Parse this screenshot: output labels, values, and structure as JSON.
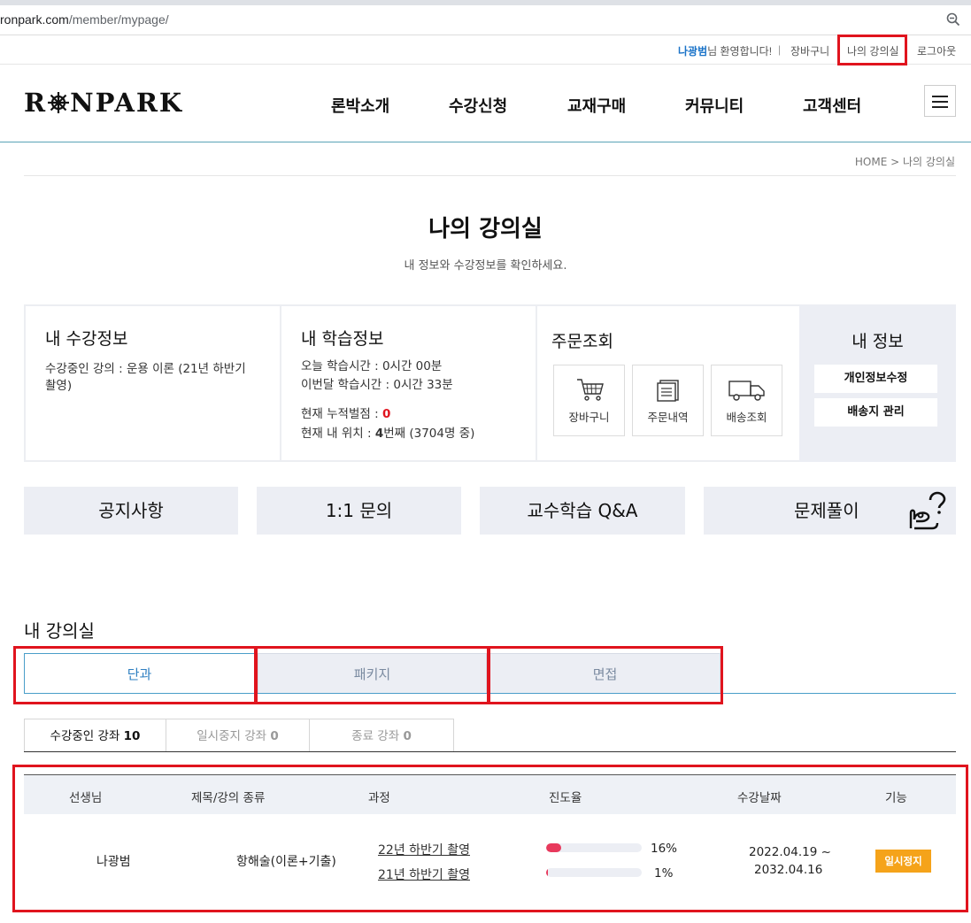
{
  "browser": {
    "url_host": "ronpark.com",
    "url_path": "/member/mypage/",
    "zoom_icon": "zoom-out-icon"
  },
  "util_nav": {
    "user_name": "나광범",
    "welcome_suffix": "님 환영합니다!",
    "separator": "|",
    "cart": "장바구니",
    "my_classroom": "나의 강의실",
    "logout": "로그아웃"
  },
  "header": {
    "logo_left": "R",
    "logo_right": "NPARK",
    "logo_icon": "ship-wheel-icon",
    "nav": [
      "론박소개",
      "수강신청",
      "교재구매",
      "커뮤니티",
      "고객센터"
    ],
    "menu_icon": "hamburger-icon"
  },
  "breadcrumb": "HOME > 나의 강의실",
  "page": {
    "title": "나의 강의실",
    "subtitle": "내 정보와 수강정보를 확인하세요."
  },
  "info": {
    "course_info": {
      "title": "내 수강정보",
      "line1": "수강중인 강의 : 운용 이론 (21년 하반기",
      "line2": "촬영)"
    },
    "study_info": {
      "title": "내 학습정보",
      "today_label": "오늘 학습시간 : ",
      "today_value": "0시간 00분",
      "month_label": "이번달 학습시간 : ",
      "month_value": "0시간 33분",
      "penalty_label": "현재 누적벌점 : ",
      "penalty_value": "0",
      "rank_label": "현재 내 위치 : ",
      "rank_value": "4",
      "rank_suffix": "번째 (3704명 중)"
    },
    "orders": {
      "title": "주문조회",
      "buttons": [
        {
          "label": "장바구니",
          "icon": "cart-icon"
        },
        {
          "label": "주문내역",
          "icon": "order-list-icon"
        },
        {
          "label": "배송조회",
          "icon": "truck-icon"
        }
      ]
    },
    "my_info": {
      "title": "내 정보",
      "edit_profile": "개인정보수정",
      "address": "배송지 관리"
    }
  },
  "quick_links": [
    "공지사항",
    "1:1 문의",
    "교수학습 Q&A",
    "문제풀이"
  ],
  "classroom": {
    "title": "내 강의실",
    "tabs": [
      "단과",
      "패키지",
      "면접"
    ],
    "active_tab": 0,
    "subtabs": [
      {
        "label": "수강중인 강좌",
        "count": "10"
      },
      {
        "label": "일시중지 강좌",
        "count": "0"
      },
      {
        "label": "종료 강좌",
        "count": "0"
      }
    ],
    "table": {
      "headers": [
        "선생님",
        "제목/강의 종류",
        "과정",
        "진도율",
        "수강날짜",
        "기능"
      ],
      "rows": [
        {
          "teacher": "나광범",
          "title": "항해술(이론+기출)",
          "courses": [
            {
              "name": "22년 하반기 촬영",
              "progress_label": "16%",
              "progress": 0.16
            },
            {
              "name": "21년 하반기 촬영",
              "progress_label": "1%",
              "progress": 0.01
            }
          ],
          "date_start": "2022.04.19 ~",
          "date_end": "2032.04.16",
          "action": "일시정지"
        }
      ]
    }
  },
  "colors": {
    "accent_blue": "#2e7fc1",
    "highlight_red": "#e0141e",
    "pause_orange": "#f5a31a",
    "progress_pink": "#e8395c",
    "panel_gray": "#eceef4"
  }
}
